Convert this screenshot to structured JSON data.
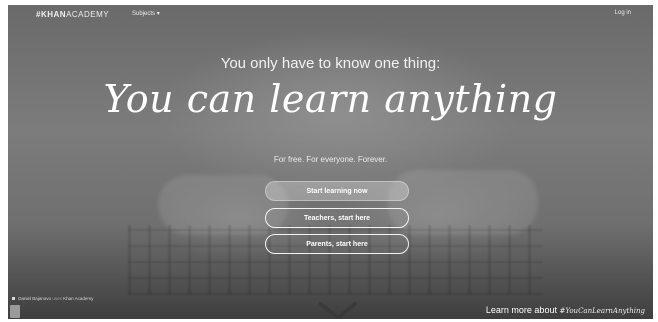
{
  "nav": {
    "logo_prefix": "#",
    "logo_bold": "KHAN",
    "logo_light": "ACADEMY",
    "subjects_label": "Subjects",
    "subjects_caret": "▾",
    "login_label": "Log in"
  },
  "hero": {
    "tagline": "You only have to know one thing:",
    "headline": "You can learn anything",
    "subheadline": "For free. For everyone. Forever."
  },
  "buttons": {
    "start": "Start learning now",
    "teachers": "Teachers, start here",
    "parents": "Parents, start here"
  },
  "footer": {
    "credit_name": "Daniel Bajanovo",
    "credit_mid": "uses",
    "credit_org": "Khan Academy",
    "learn_more": "Learn more about",
    "hashtag": "#YouCanLearnAnything"
  },
  "colors": {
    "text": "#ffffff",
    "background": "#6f6f6f"
  },
  "icons": [
    "chevron-down-icon"
  ]
}
